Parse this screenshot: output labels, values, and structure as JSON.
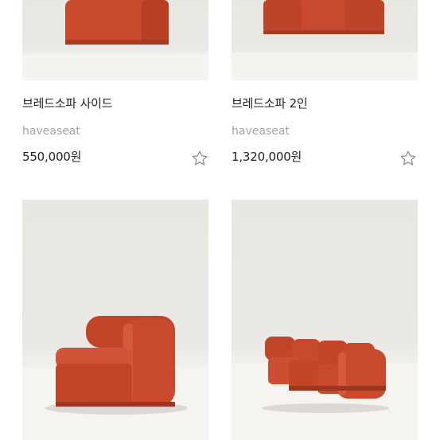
{
  "products": [
    {
      "title": "브레드소파 사이드",
      "brand": "haveaseat",
      "price": "550,000원",
      "star": "star-outline-icon"
    },
    {
      "title": "브레드소파 2인",
      "brand": "haveaseat",
      "price": "1,320,000원",
      "star": "star-outline-icon"
    }
  ],
  "colors": {
    "sofa": "#c8492c",
    "sofa_shadow": "#a93a22",
    "wall": "#e9e7e2",
    "floor": "#f5f4f1"
  }
}
